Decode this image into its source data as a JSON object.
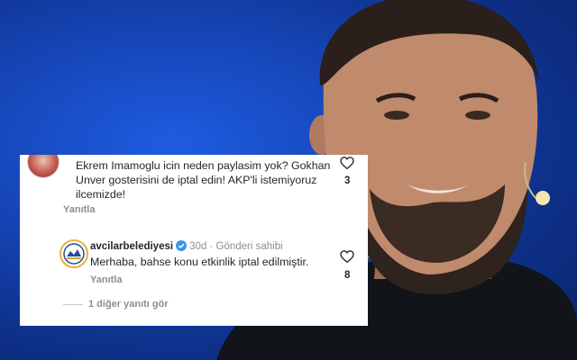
{
  "comments": [
    {
      "text": "Ekrem Imamoglu icin neden paylasim yok? Gokhan Unver gosterisini de iptal edin! AKP'li istemiyoruz ilcemizde!",
      "likes": "3",
      "reply_label": "Yanıtla"
    },
    {
      "username": "avcilarbelediyesi",
      "time": "30d",
      "separator": "·",
      "badge": "Gönderi sahibi",
      "text": "Merhaba, bahse konu etkinlik iptal edilmiştir.",
      "likes": "8",
      "reply_label": "Yanıtla"
    }
  ],
  "view_replies": "1 diğer yanıtı gör",
  "icons": {
    "like": "heart-outline-icon",
    "verified": "verified-badge-icon"
  },
  "colors": {
    "background": "#1646b8",
    "verified": "#3897f0",
    "muted_text": "#8e8e8e",
    "text": "#262626"
  }
}
